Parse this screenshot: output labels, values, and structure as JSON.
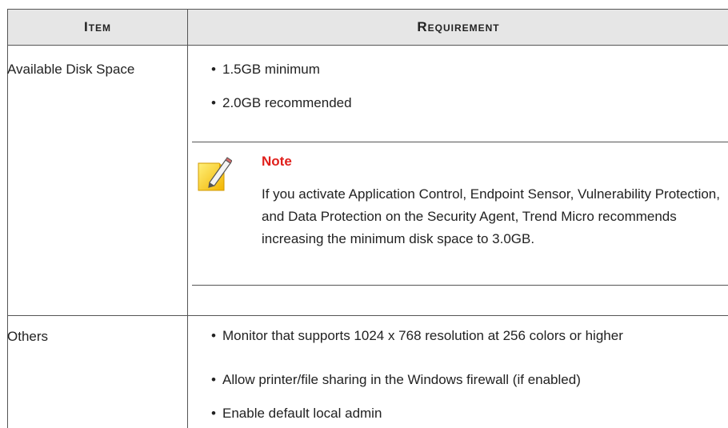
{
  "table": {
    "headers": {
      "item": "Item",
      "requirement": "Requirement"
    },
    "rows": [
      {
        "item": "Available Disk Space",
        "bullets": [
          "1.5GB minimum",
          "2.0GB recommended"
        ],
        "note": {
          "title": "Note",
          "body": "If you activate Application Control, Endpoint Sensor, Vulnerability Protection, and Data Protection on the Security Agent, Trend Micro recommends increasing the minimum disk space to 3.0GB."
        }
      },
      {
        "item": "Others",
        "bullets": [
          "Monitor that supports 1024 x 768 resolution at 256 colors or higher",
          "Allow printer/file sharing in the Windows firewall (if enabled)",
          "Enable default local admin"
        ]
      }
    ]
  },
  "colors": {
    "header_bg": "#e6e6e6",
    "note_title": "#e0201c",
    "note_icon": "#f5c400"
  },
  "icons": {
    "note": "note-pencil-icon"
  }
}
